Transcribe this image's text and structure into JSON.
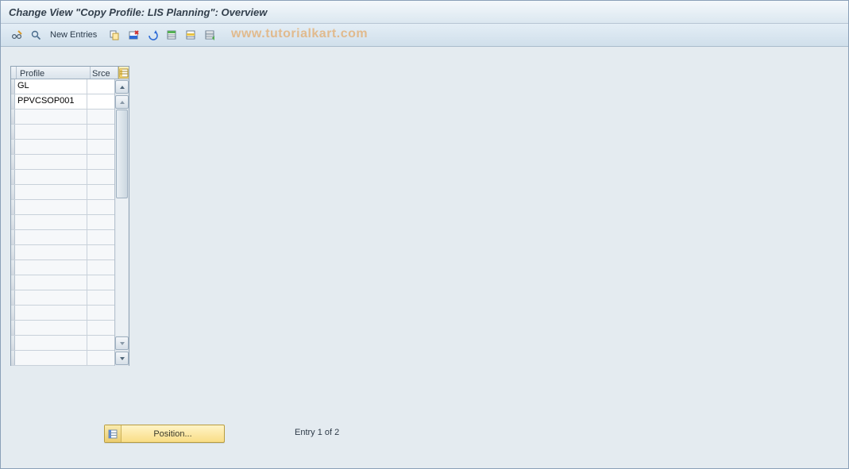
{
  "title": "Change View \"Copy Profile: LIS Planning\": Overview",
  "toolbar": {
    "new_entries_label": "New Entries"
  },
  "watermark": "www.tutorialkart.com",
  "grid": {
    "columns": {
      "profile": "Profile",
      "srce": "Srce"
    },
    "rows": [
      {
        "profile": "GL",
        "srce": ""
      },
      {
        "profile": "PPVCSOP001",
        "srce": ""
      }
    ],
    "empty_row_count": 17
  },
  "position_button_label": "Position...",
  "entry_status": "Entry 1 of 2"
}
